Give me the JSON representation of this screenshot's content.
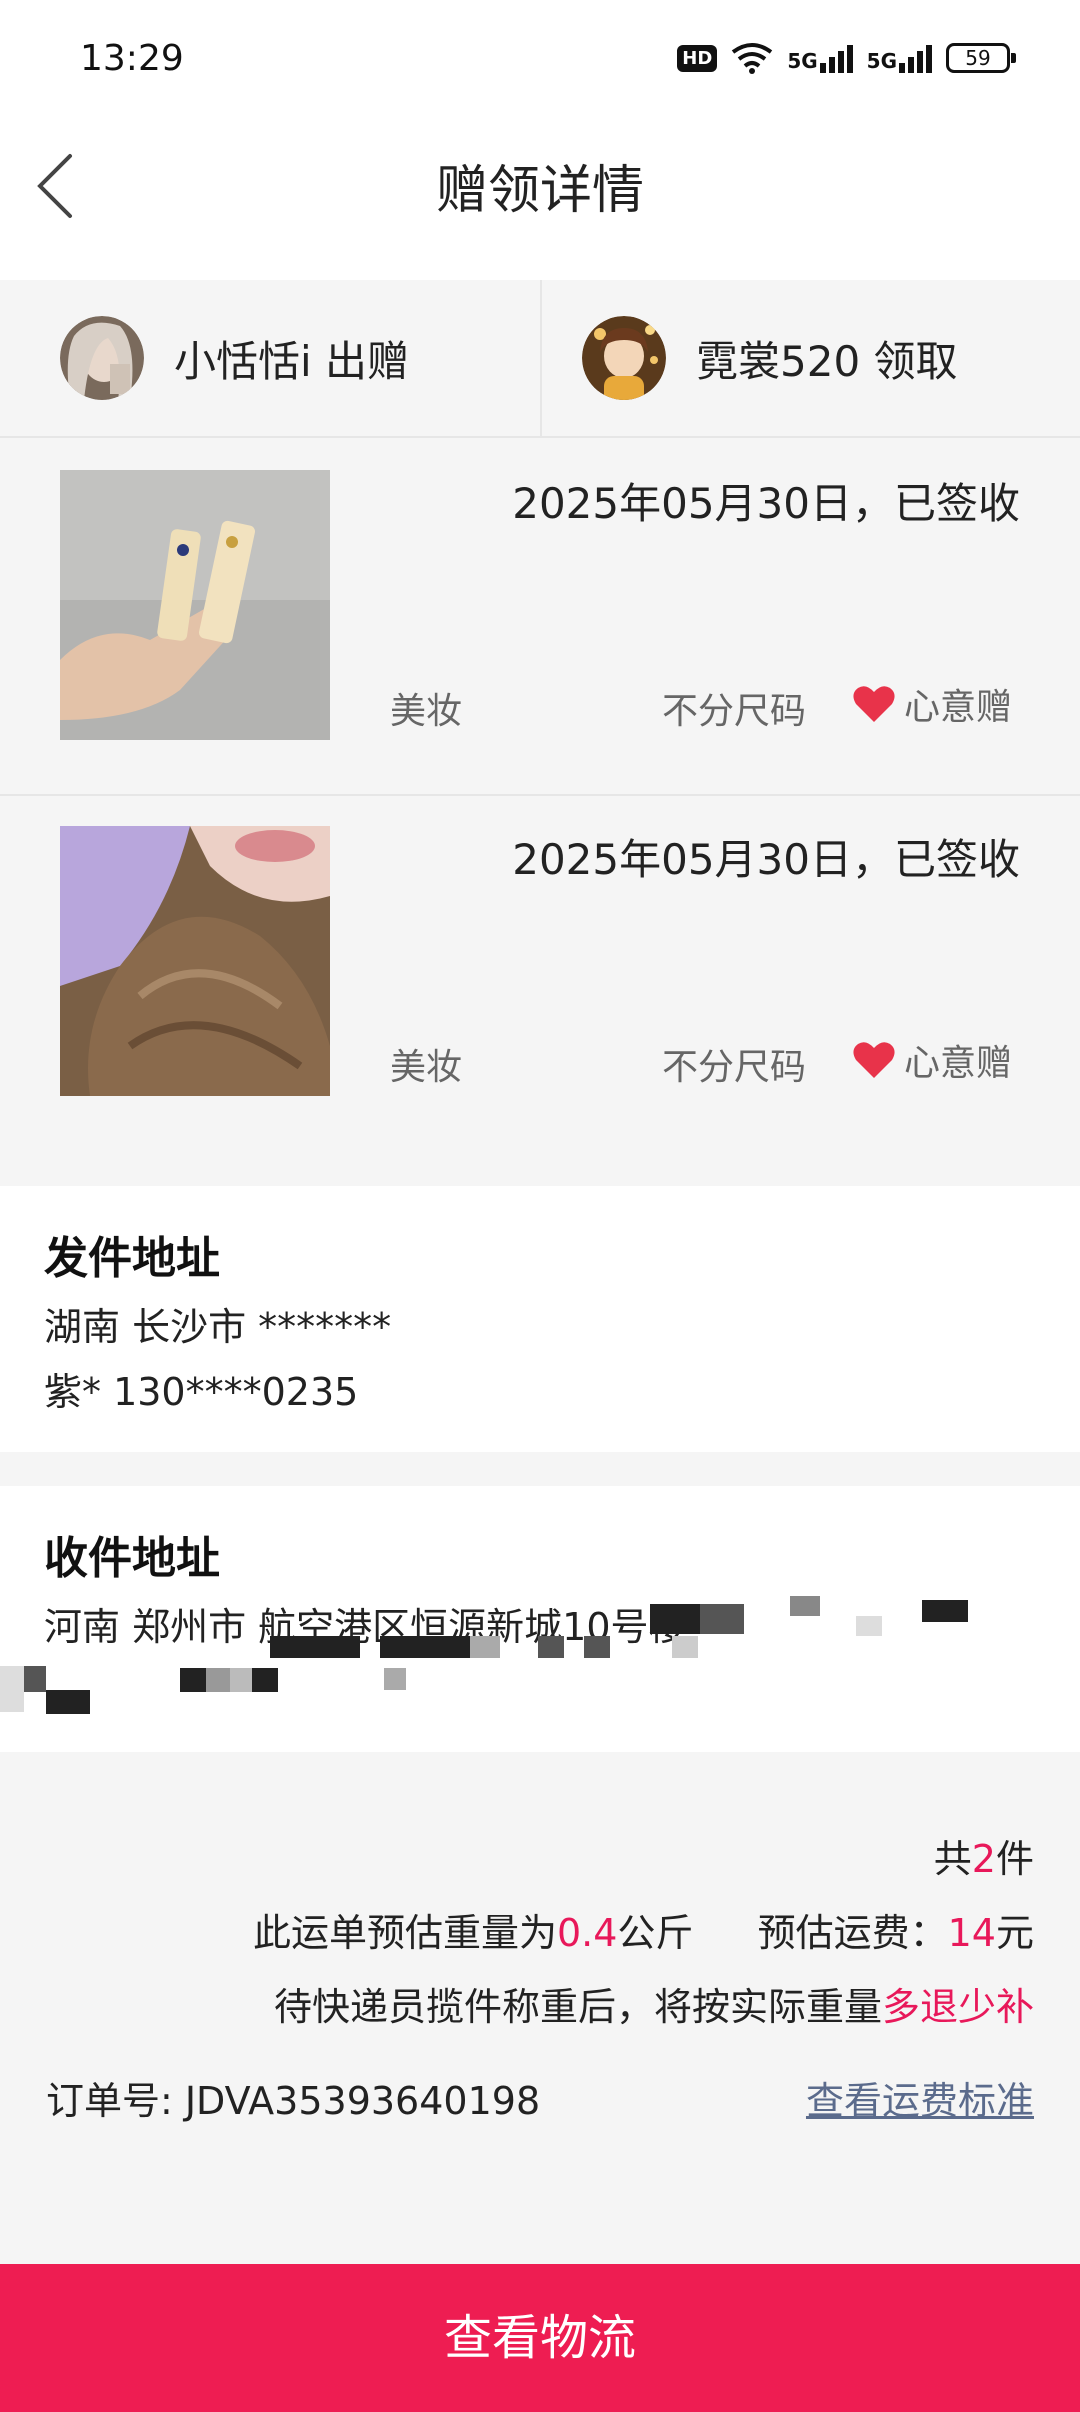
{
  "status_bar": {
    "time": "13:29",
    "hd_label": "HD",
    "signal_1": "5G",
    "signal_2": "5G",
    "battery": "59"
  },
  "nav": {
    "back_icon": "chevron-left-icon",
    "title": "赠领详情"
  },
  "parties": {
    "sender_label": "小恬恬i 出赠",
    "receiver_label": "霓裳520 领取"
  },
  "items": [
    {
      "date": "2025年05月30日，已签收",
      "category": "美妆",
      "size": "不分尺码",
      "gift_label": "心意赠",
      "gift_icon": "heart-icon"
    },
    {
      "date": "2025年05月30日，已签收",
      "category": "美妆",
      "size": "不分尺码",
      "gift_label": "心意赠",
      "gift_icon": "heart-icon"
    }
  ],
  "send_address": {
    "title": "发件地址",
    "line1": "湖南 长沙市 *******",
    "line2": "紫* 130****0235"
  },
  "receive_address": {
    "title": "收件地址",
    "line1": "河南 郑州市 航空港区恒源新城10号楼"
  },
  "summary": {
    "count_prefix": "共",
    "count": "2",
    "count_suffix": "件",
    "weight_prefix": "此运单预估重量为",
    "weight": "0.4",
    "weight_unit": "公斤",
    "fee_prefix": "预估运费：",
    "fee": "14",
    "fee_unit": "元",
    "note_prefix": "待快递员揽件称重后，将按实际重量",
    "note_highlight": "多退少补",
    "order_label": "订单号:",
    "order_number": "JDVA35393640198",
    "fee_link": "查看运费标准"
  },
  "bottom_button": "查看物流",
  "colors": {
    "accent": "#ee1d52",
    "highlight": "#e8185a",
    "link": "#5b6b8c",
    "heart": "#e8334a"
  }
}
